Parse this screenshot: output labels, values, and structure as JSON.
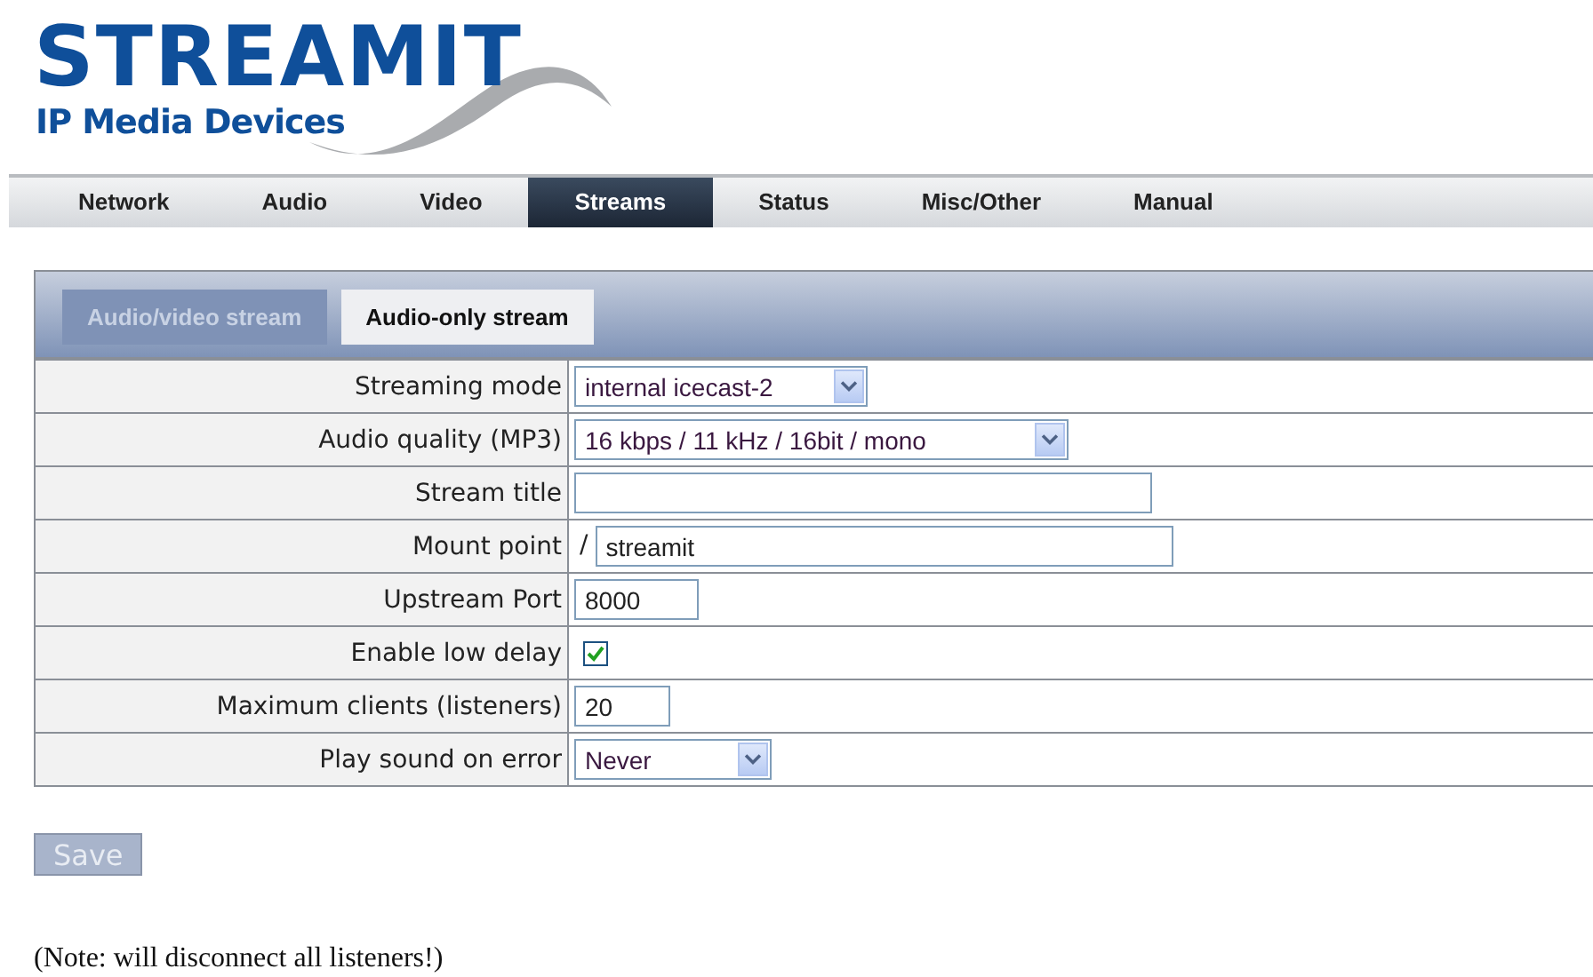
{
  "logo": {
    "name": "STREAMIT",
    "tagline": "IP Media Devices"
  },
  "nav": [
    {
      "label": "Network",
      "selected": false
    },
    {
      "label": "Audio",
      "selected": false
    },
    {
      "label": "Video",
      "selected": false
    },
    {
      "label": "Streams",
      "selected": true
    },
    {
      "label": "Status",
      "selected": false
    },
    {
      "label": "Misc/Other",
      "selected": false
    },
    {
      "label": "Manual",
      "selected": false
    }
  ],
  "subtabs": [
    {
      "label": "Audio/video stream",
      "selected": false
    },
    {
      "label": "Audio-only stream",
      "selected": true
    }
  ],
  "rows": [
    {
      "label": "Streaming mode",
      "kind": "select",
      "value": "internal icecast-2"
    },
    {
      "label": "Audio quality (MP3)",
      "kind": "select",
      "value": "16 kbps / 11 kHz / 16bit / mono"
    },
    {
      "label": "Stream title",
      "kind": "text"
    },
    {
      "label": "Mount point",
      "kind": "text",
      "prefix": "/",
      "value": "streamit"
    },
    {
      "label": "Upstream Port",
      "kind": "text",
      "value": "8000"
    },
    {
      "label": "Enable low delay",
      "kind": "checkbox",
      "checked": true
    },
    {
      "label": "Maximum clients (listeners)",
      "kind": "text",
      "value": "20"
    },
    {
      "label": "Play sound on error",
      "kind": "select",
      "value": "Never"
    }
  ],
  "save_button": {
    "label": "Save",
    "disabled": true
  },
  "note": "(Note: will disconnect all listeners!)"
}
